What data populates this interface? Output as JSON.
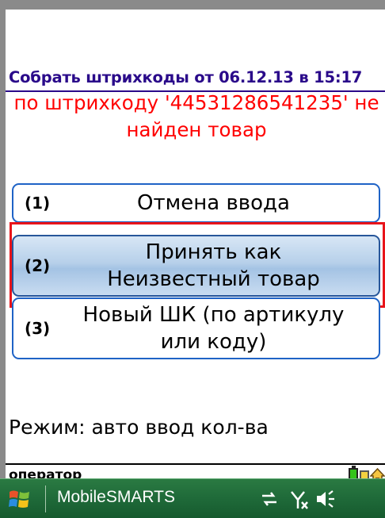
{
  "title": "Собрать штрихкоды от 06.12.13 в 15:17",
  "message": "по штрихкоду '44531286541235' не найден товар",
  "options": [
    {
      "num": "(1)",
      "label": "Отмена ввода"
    },
    {
      "num": "(2)",
      "label": "Принять как Неизвестный товар"
    },
    {
      "num": "(3)",
      "label": "Новый ШК (по артикулу или коду)"
    }
  ],
  "mode": "Режим:  авто ввод кол-ва",
  "status": {
    "user": "оператор"
  },
  "taskbar": {
    "app_name": "MobileSMARTS"
  },
  "colors": {
    "title": "#2a0a8a",
    "error": "#ff0000",
    "button_border": "#1f63c6",
    "selection": "#e8141a",
    "taskbar": "#1f6a39"
  }
}
